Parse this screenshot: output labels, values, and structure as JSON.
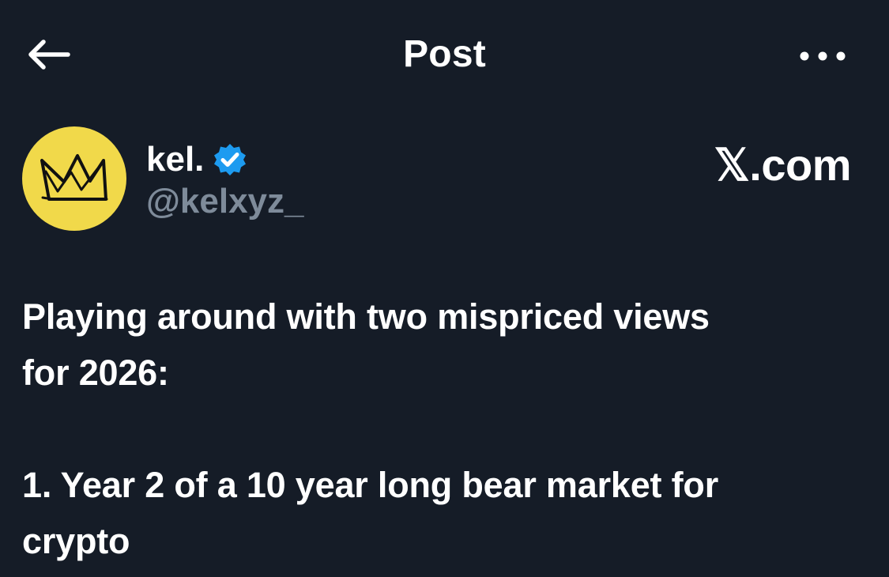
{
  "header": {
    "title": "Post",
    "back_icon": "arrow-left-icon",
    "more_icon": "more-horizontal-icon"
  },
  "author": {
    "display_name": "kel.",
    "handle": "@kelxyz_",
    "verified_icon": "verified-badge-icon",
    "avatar_icon": "crown-icon"
  },
  "watermark": {
    "text": "𝕏.com"
  },
  "post": {
    "line1": "Playing around with two mispriced views",
    "line2": "for 2026:",
    "line3": "1. Year 2 of a 10 year long bear market for",
    "line4": "crypto"
  },
  "colors": {
    "background": "#151c27",
    "text": "#ffffff",
    "secondary_text": "#7e8b9a",
    "verified_blue": "#1d9bf0",
    "avatar_yellow": "#f1d94a"
  }
}
